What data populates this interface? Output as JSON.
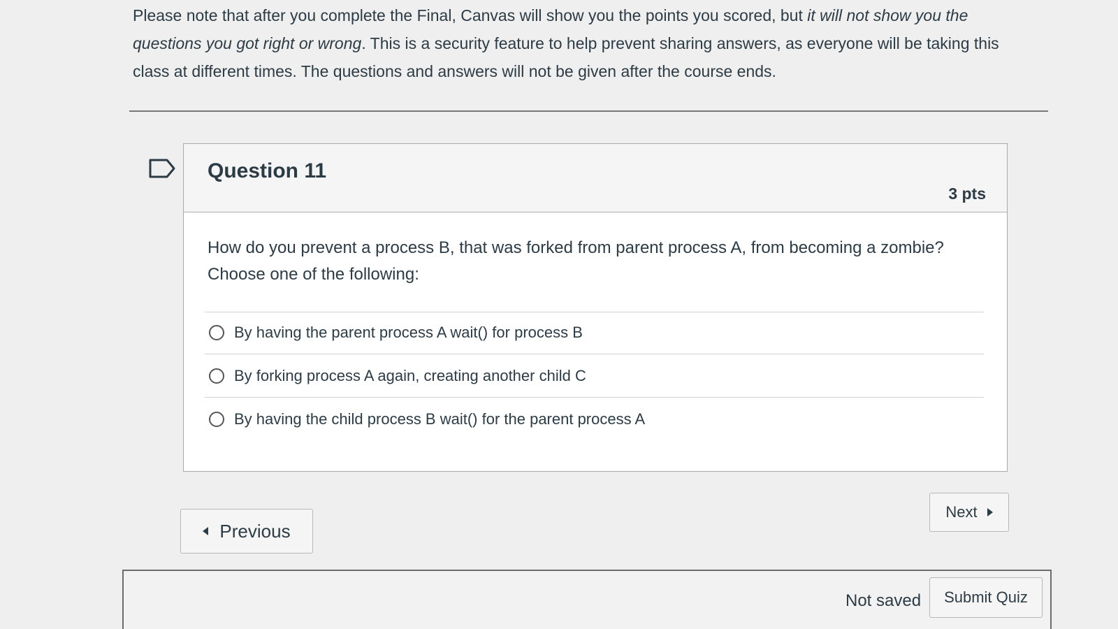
{
  "notice": {
    "part1": "Please note that after you complete the Final, Canvas will show you the points you scored, but ",
    "part2_italic": "it will not show you the questions you got right or wrong",
    "part3": ". This is a security feature to help prevent sharing answers, as everyone will be taking this class at different times. The questions and answers will not be given after the course ends."
  },
  "question": {
    "flag_icon": "flag-icon",
    "title": "Question 11",
    "points": "3 pts",
    "text_line1": "How do you prevent a process B, that was forked from parent process A, from becoming a zombie?",
    "text_line2": "Choose one of the following:",
    "answers": [
      {
        "label": "By having the parent process A wait() for process B",
        "selected": false
      },
      {
        "label": "By forking process A again, creating another child C",
        "selected": false
      },
      {
        "label": "By having the child process B wait() for the parent process A",
        "selected": false
      }
    ]
  },
  "nav": {
    "previous_label": "Previous",
    "next_label": "Next"
  },
  "footer": {
    "save_status": "Not saved",
    "submit_label": "Submit Quiz"
  }
}
